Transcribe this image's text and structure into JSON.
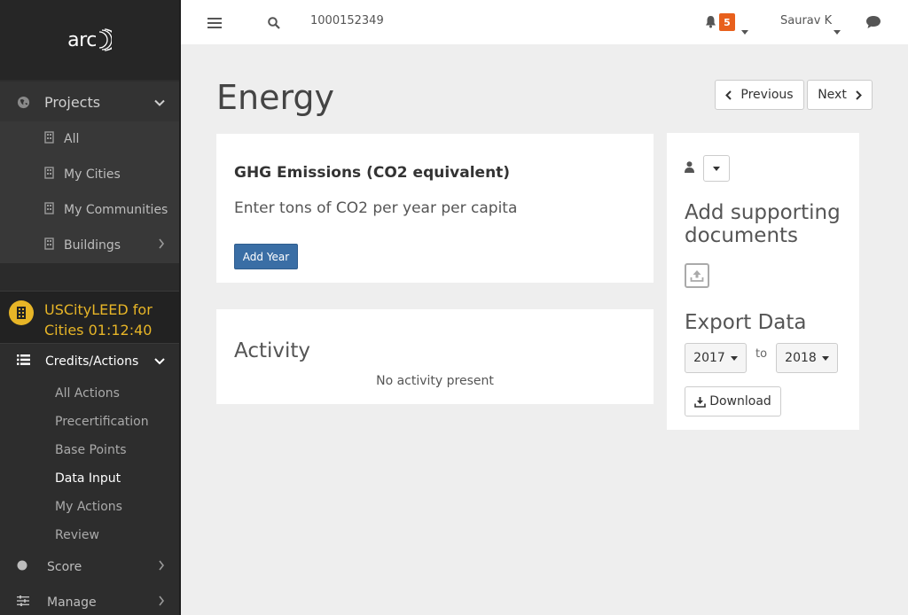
{
  "logo": {
    "text": "arc"
  },
  "sidebar": {
    "projects_label": "Projects",
    "project_items": [
      {
        "label": "All",
        "has_chevron": false
      },
      {
        "label": "My Cities",
        "has_chevron": false
      },
      {
        "label": "My Communities",
        "has_chevron": false
      },
      {
        "label": "Buildings",
        "has_chevron": true
      }
    ],
    "current_project": {
      "name": "USCityLEED for Cities 01:12:40",
      "color": "#e7b527"
    },
    "credits_label": "Credits/Actions",
    "credit_items": [
      {
        "label": "All Actions",
        "active": false
      },
      {
        "label": "Precertification",
        "active": false
      },
      {
        "label": "Base Points",
        "active": false
      },
      {
        "label": "Data Input",
        "active": true
      },
      {
        "label": "My Actions",
        "active": false
      },
      {
        "label": "Review",
        "active": false
      }
    ],
    "score_label": "Score",
    "manage_label": "Manage"
  },
  "topbar": {
    "search_value": "1000152349",
    "notification_count": "5",
    "notification_color": "#e8601c",
    "user_name": "Saurav K"
  },
  "main": {
    "title": "Energy",
    "previous_label": "Previous",
    "next_label": "Next",
    "ghg": {
      "title": "GHG Emissions (CO2 equivalent)",
      "subtitle": "Enter tons of CO2 per year per capita",
      "add_year_label": "Add Year",
      "button_color": "#3a6ea5"
    },
    "activity": {
      "title": "Activity",
      "empty_text": "No activity present"
    },
    "side_panel": {
      "supporting_docs_line1": "Add supporting",
      "supporting_docs_line2": "documents",
      "export_title": "Export Data",
      "from_year": "2017",
      "to_label": "to",
      "to_year": "2018",
      "download_label": "Download"
    }
  }
}
